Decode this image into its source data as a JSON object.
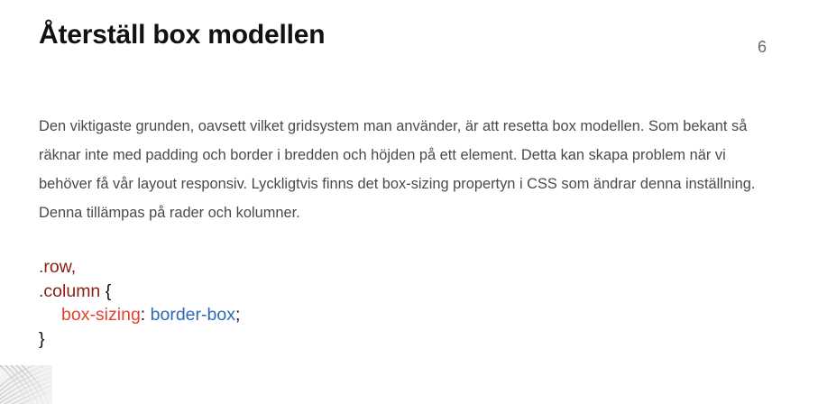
{
  "slide": {
    "title": "Återställ box modellen",
    "page_number": "6",
    "paragraph": "Den viktigaste grunden, oavsett vilket gridsystem man använder, är att resetta box modellen. Som bekant så räknar inte med padding och border i bredden och höjden på ett element. Detta kan skapa problem när vi behöver få vår layout responsiv. Lyckligtvis finns det box-sizing propertyn i CSS som ändrar denna inställning. Denna tillämpas på rader och kolumner."
  },
  "code": {
    "selector_1": ".row,",
    "selector_2": ".column",
    "open_brace": "{",
    "property": "box-sizing",
    "colon": ":",
    "value": "border-box",
    "semicolon": ";",
    "close_brace": "}"
  },
  "colors": {
    "selector": "#8b1e14",
    "property": "#e8412b",
    "value": "#2a6ab8",
    "title": "#111111",
    "body_text": "#4a4a4a"
  }
}
